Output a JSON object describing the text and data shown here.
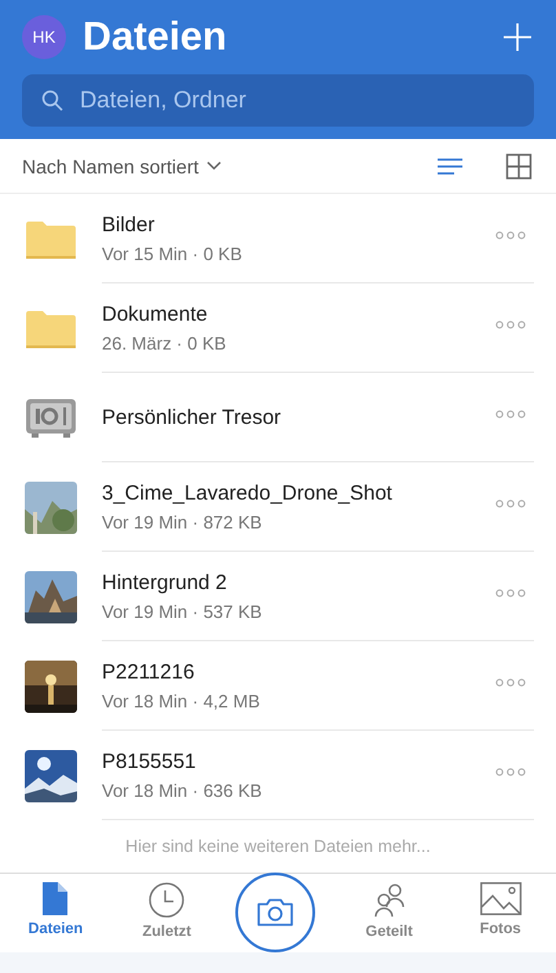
{
  "header": {
    "avatar": "HK",
    "title": "Dateien"
  },
  "search": {
    "placeholder": "Dateien, Ordner"
  },
  "sort": {
    "label": "Nach Namen sortiert",
    "views": [
      {
        "kind": "list",
        "selected": true
      },
      {
        "kind": "grid",
        "selected": false
      }
    ]
  },
  "files": [
    {
      "kind": "folder",
      "name": "Bilder",
      "meta": "Vor 15 Min · 0 KB"
    },
    {
      "kind": "folder",
      "name": "Dokumente",
      "meta": "26. März · 0 KB"
    },
    {
      "kind": "vault",
      "name": "Persönlicher Tresor"
    },
    {
      "kind": "picture",
      "name": "3_Cime_Lavaredo_Drone_Shot",
      "meta": "Vor 19 Min · 872 KB"
    },
    {
      "kind": "picture",
      "name": "Hintergrund 2",
      "meta": "Vor 19 Min · 537 KB"
    },
    {
      "kind": "picture",
      "name": "P2211216",
      "meta": "Vor 18 Min · 4,2 MB"
    },
    {
      "kind": "picture",
      "name": "P8155551",
      "meta": "Vor 18 Min · 636 KB"
    }
  ],
  "end_note": "Hier sind keine weiteren Dateien mehr...",
  "tabs": [
    {
      "kind": "files",
      "label": "Dateien",
      "selected": true
    },
    {
      "kind": "recent",
      "label": "Zuletzt",
      "selected": false
    },
    {
      "kind": "camera"
    },
    {
      "kind": "shared",
      "label": "Geteilt",
      "selected": false
    },
    {
      "kind": "photos",
      "label": "Fotos",
      "selected": false
    }
  ]
}
